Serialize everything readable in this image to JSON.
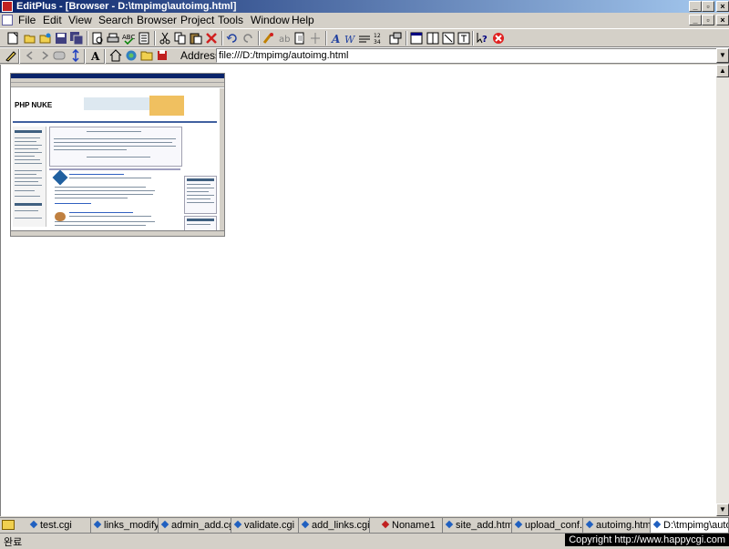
{
  "window": {
    "title": "EditPlus - [Browser - D:\\tmpimg\\autoimg.html]",
    "min_glyph": "_",
    "max_glyph": "▫",
    "close_glyph": "×"
  },
  "menu": [
    "File",
    "Edit",
    "View",
    "Search",
    "Browser",
    "Project",
    "Tools",
    "Window",
    "Help"
  ],
  "toolbar": {
    "icons": [
      "new-file-icon",
      "open-icon",
      "open-remote-icon",
      "save-icon",
      "save-all-icon",
      "print-preview-icon",
      "print-icon",
      "spell-check-icon",
      "document-icon",
      "cut-icon",
      "copy-icon",
      "paste-icon",
      "delete-icon",
      "undo-icon",
      "redo-icon",
      "find-icon",
      "replace-icon",
      "copy-format-icon",
      "hex-icon",
      "font-icon",
      "word-wrap-icon",
      "ruler-icon",
      "line-number-icon",
      "settings-icon",
      "window-1-icon",
      "window-2-icon",
      "window-3-icon",
      "window-4-icon",
      "help-icon",
      "stop-icon"
    ]
  },
  "browser": {
    "address_label": "Address",
    "address_value": "file:///D:/tmpimg/autoimg.html",
    "thumbnail_logo": "PHP NUKE"
  },
  "tabs": [
    {
      "label": "test.cgi",
      "active": false
    },
    {
      "label": "links_modify.cgi",
      "active": false
    },
    {
      "label": "admin_add.cgi",
      "active": false
    },
    {
      "label": "validate.cgi",
      "active": false
    },
    {
      "label": "add_links.cgi",
      "active": false
    },
    {
      "label": "Noname1",
      "active": false
    },
    {
      "label": "site_add.html",
      "active": false
    },
    {
      "label": "upload_conf.cgi",
      "active": false
    },
    {
      "label": "autoimg.html",
      "active": false
    },
    {
      "label": "D:\\tmpimg\\autoimg.html",
      "active": true
    }
  ],
  "status": {
    "text": "완료",
    "copyright": "Copyright  http://www.happycgi.com"
  },
  "colors": {
    "title_start": "#0a246a",
    "title_end": "#a6caf0",
    "chrome": "#d4d0c8",
    "stop_red": "#e02020"
  }
}
